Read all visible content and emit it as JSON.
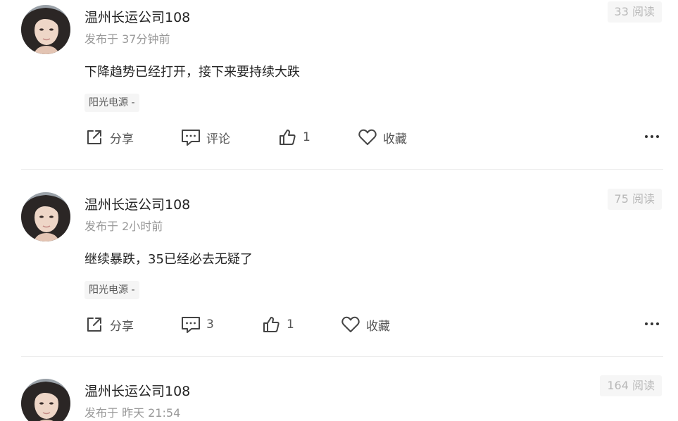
{
  "posts": [
    {
      "author": "温州长运公司108",
      "time": "发布于 37分钟前",
      "reads": "33 阅读",
      "content": "下降趋势已经打开，接下来要持续大跌",
      "tag": "阳光电源 -",
      "actions": {
        "share": "分享",
        "comment": "评论",
        "like": "1",
        "favorite": "收藏"
      }
    },
    {
      "author": "温州长运公司108",
      "time": "发布于 2小时前",
      "reads": "75 阅读",
      "content": "继续暴跌，35已经必去无疑了",
      "tag": "阳光电源 -",
      "actions": {
        "share": "分享",
        "comment": "3",
        "like": "1",
        "favorite": "收藏"
      }
    },
    {
      "author": "温州长运公司108",
      "time": "发布于 昨天 21:54",
      "reads": "164 阅读"
    }
  ],
  "icons": {
    "share": "share-icon",
    "comment": "comment-icon",
    "like": "thumbs-up-icon",
    "favorite": "heart-icon",
    "more": "more-dots-icon"
  }
}
